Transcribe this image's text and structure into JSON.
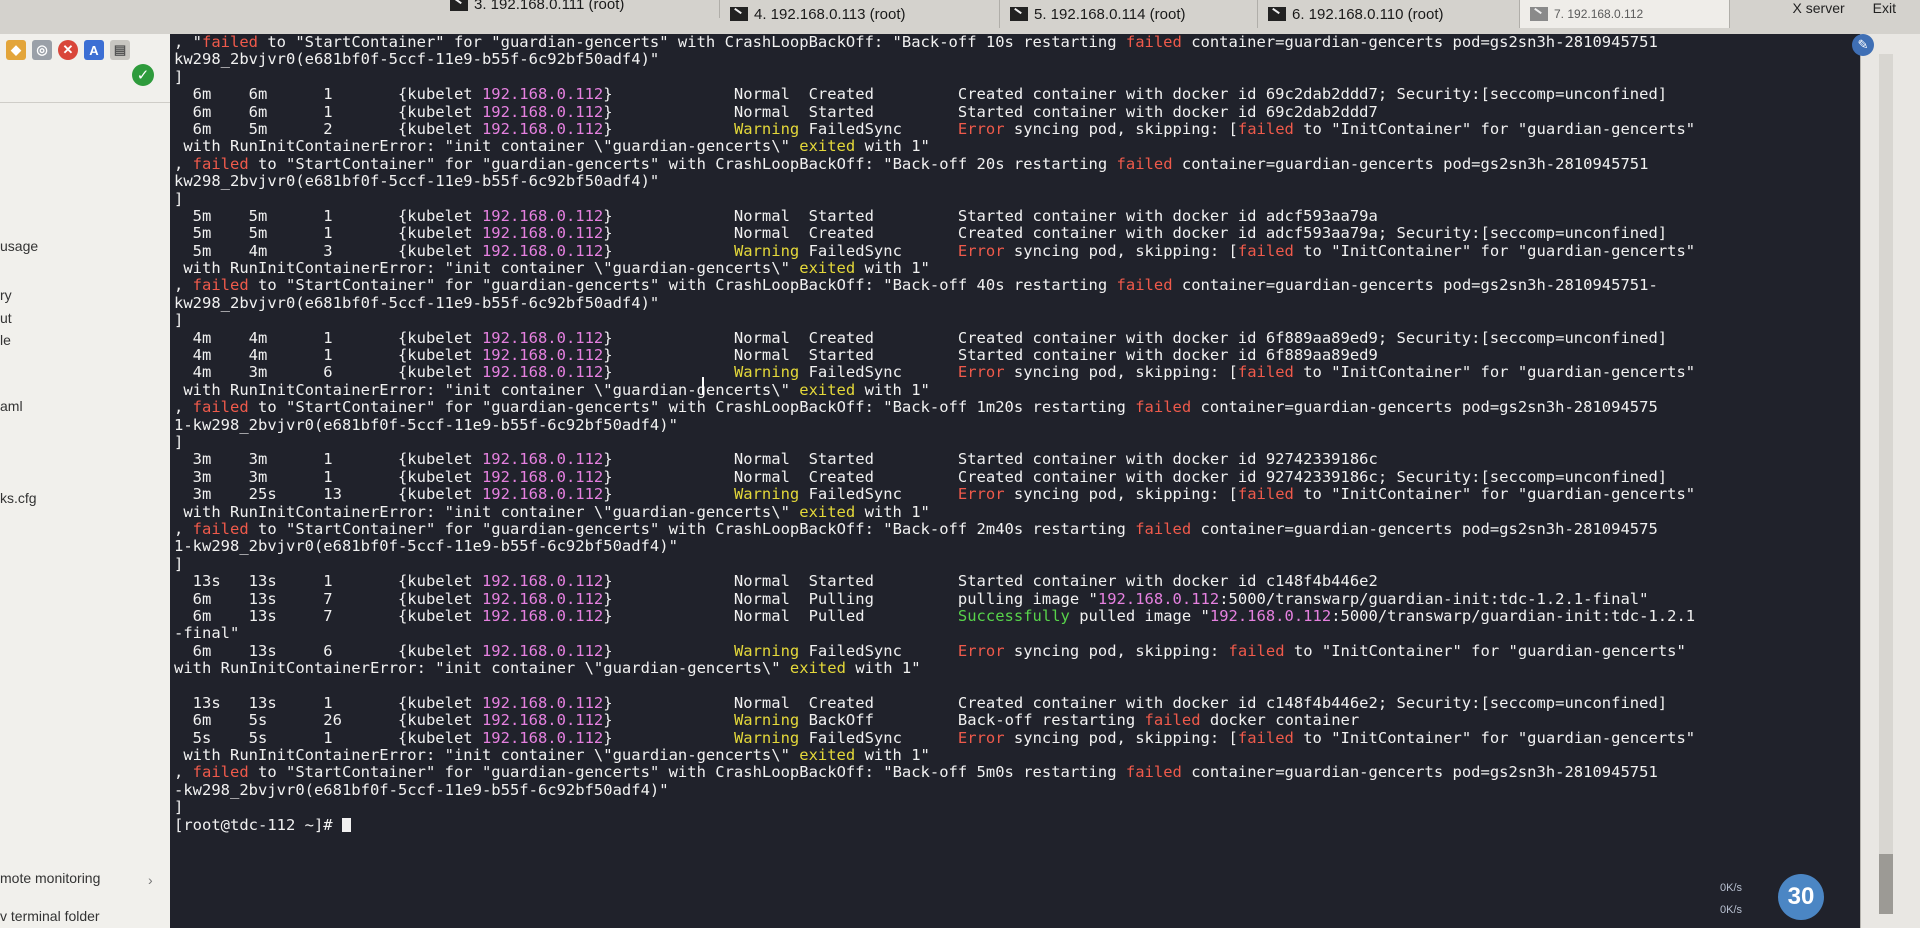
{
  "tabs": [
    {
      "label": "3. 192.168.0.111 (root)"
    },
    {
      "label": "4. 192.168.0.113 (root)"
    },
    {
      "label": "5. 192.168.0.114 (root)"
    },
    {
      "label": "6. 192.168.0.110 (root)"
    },
    {
      "label": "7. 192.168.0.112"
    }
  ],
  "window_controls": {
    "xserver": "X server",
    "exit": "Exit"
  },
  "sidebar": {
    "items": [
      "usage",
      "ry",
      "ut",
      "le",
      "aml",
      "ks.cfg",
      "mote monitoring",
      "v terminal folder"
    ],
    "expander": "›"
  },
  "terminal": {
    "lines": [
      [
        {
          "c": "w",
          "t": ", \""
        },
        {
          "c": "r",
          "t": "failed"
        },
        {
          "c": "w",
          "t": " to \"StartContainer\" for \"guardian-gencerts\" with CrashLoopBackOff: \"Back-off 10s restarting "
        },
        {
          "c": "r",
          "t": "failed"
        },
        {
          "c": "w",
          "t": " container=guardian-gencerts pod=gs2sn3h-2810945751"
        }
      ],
      [
        {
          "c": "w",
          "t": "kw298_2bvjvr0(e681bf0f-5ccf-11e9-b55f-6c92bf50adf4)\""
        }
      ],
      [
        {
          "c": "w",
          "t": "]"
        }
      ],
      [
        {
          "c": "w",
          "t": "  6m    6m      1       {kubelet "
        },
        {
          "c": "m",
          "t": "192.168.0.112"
        },
        {
          "c": "w",
          "t": "}             Normal  Created         Created container with docker id 69c2dab2ddd7; Security:[seccomp=unconfined]"
        }
      ],
      [
        {
          "c": "w",
          "t": "  6m    6m      1       {kubelet "
        },
        {
          "c": "m",
          "t": "192.168.0.112"
        },
        {
          "c": "w",
          "t": "}             Normal  Started         Started container with docker id 69c2dab2ddd7"
        }
      ],
      [
        {
          "c": "w",
          "t": "  6m    5m      2       {kubelet "
        },
        {
          "c": "m",
          "t": "192.168.0.112"
        },
        {
          "c": "w",
          "t": "}             "
        },
        {
          "c": "y",
          "t": "Warning"
        },
        {
          "c": "w",
          "t": " FailedSync      "
        },
        {
          "c": "r",
          "t": "Error"
        },
        {
          "c": "w",
          "t": " syncing pod, skipping: ["
        },
        {
          "c": "r",
          "t": "failed"
        },
        {
          "c": "w",
          "t": " to \"InitContainer\" for \"guardian-gencerts\""
        }
      ],
      [
        {
          "c": "w",
          "t": " with RunInitContainerError: \"init container \\\"guardian-gencerts\\\" "
        },
        {
          "c": "y",
          "t": "exited"
        },
        {
          "c": "w",
          "t": " with 1\""
        }
      ],
      [
        {
          "c": "w",
          "t": ", "
        },
        {
          "c": "r",
          "t": "failed"
        },
        {
          "c": "w",
          "t": " to \"StartContainer\" for \"guardian-gencerts\" with CrashLoopBackOff: \"Back-off 20s restarting "
        },
        {
          "c": "r",
          "t": "failed"
        },
        {
          "c": "w",
          "t": " container=guardian-gencerts pod=gs2sn3h-2810945751"
        }
      ],
      [
        {
          "c": "w",
          "t": "kw298_2bvjvr0(e681bf0f-5ccf-11e9-b55f-6c92bf50adf4)\""
        }
      ],
      [
        {
          "c": "w",
          "t": "]"
        }
      ],
      [
        {
          "c": "w",
          "t": "  5m    5m      1       {kubelet "
        },
        {
          "c": "m",
          "t": "192.168.0.112"
        },
        {
          "c": "w",
          "t": "}             Normal  Started         Started container with docker id adcf593aa79a"
        }
      ],
      [
        {
          "c": "w",
          "t": "  5m    5m      1       {kubelet "
        },
        {
          "c": "m",
          "t": "192.168.0.112"
        },
        {
          "c": "w",
          "t": "}             Normal  Created         Created container with docker id adcf593aa79a; Security:[seccomp=unconfined]"
        }
      ],
      [
        {
          "c": "w",
          "t": "  5m    4m      3       {kubelet "
        },
        {
          "c": "m",
          "t": "192.168.0.112"
        },
        {
          "c": "w",
          "t": "}             "
        },
        {
          "c": "y",
          "t": "Warning"
        },
        {
          "c": "w",
          "t": " FailedSync      "
        },
        {
          "c": "r",
          "t": "Error"
        },
        {
          "c": "w",
          "t": " syncing pod, skipping: ["
        },
        {
          "c": "r",
          "t": "failed"
        },
        {
          "c": "w",
          "t": " to \"InitContainer\" for \"guardian-gencerts\""
        }
      ],
      [
        {
          "c": "w",
          "t": " with RunInitContainerError: \"init container \\\"guardian-gencerts\\\" "
        },
        {
          "c": "y",
          "t": "exited"
        },
        {
          "c": "w",
          "t": " with 1\""
        }
      ],
      [
        {
          "c": "w",
          "t": ", "
        },
        {
          "c": "r",
          "t": "failed"
        },
        {
          "c": "w",
          "t": " to \"StartContainer\" for \"guardian-gencerts\" with CrashLoopBackOff: \"Back-off 40s restarting "
        },
        {
          "c": "r",
          "t": "failed"
        },
        {
          "c": "w",
          "t": " container=guardian-gencerts pod=gs2sn3h-2810945751-"
        }
      ],
      [
        {
          "c": "w",
          "t": "kw298_2bvjvr0(e681bf0f-5ccf-11e9-b55f-6c92bf50adf4)\""
        }
      ],
      [
        {
          "c": "w",
          "t": "]"
        }
      ],
      [
        {
          "c": "w",
          "t": "  4m    4m      1       {kubelet "
        },
        {
          "c": "m",
          "t": "192.168.0.112"
        },
        {
          "c": "w",
          "t": "}             Normal  Created         Created container with docker id 6f889aa89ed9; Security:[seccomp=unconfined]"
        }
      ],
      [
        {
          "c": "w",
          "t": "  4m    4m      1       {kubelet "
        },
        {
          "c": "m",
          "t": "192.168.0.112"
        },
        {
          "c": "w",
          "t": "}             Normal  Started         Started container with docker id 6f889aa89ed9"
        }
      ],
      [
        {
          "c": "w",
          "t": "  4m    3m      6       {kubelet "
        },
        {
          "c": "m",
          "t": "192.168.0.112"
        },
        {
          "c": "w",
          "t": "}             "
        },
        {
          "c": "y",
          "t": "Warning"
        },
        {
          "c": "w",
          "t": " FailedSync      "
        },
        {
          "c": "r",
          "t": "Error"
        },
        {
          "c": "w",
          "t": " syncing pod, skipping: ["
        },
        {
          "c": "r",
          "t": "failed"
        },
        {
          "c": "w",
          "t": " to \"InitContainer\" for \"guardian-gencerts\""
        }
      ],
      [
        {
          "c": "w",
          "t": " with RunInitContainerError: \"init container \\\"guardian-gencerts\\\" "
        },
        {
          "c": "y",
          "t": "exited"
        },
        {
          "c": "w",
          "t": " with 1\""
        }
      ],
      [
        {
          "c": "w",
          "t": ", "
        },
        {
          "c": "r",
          "t": "failed"
        },
        {
          "c": "w",
          "t": " to \"StartContainer\" for \"guardian-gencerts\" with CrashLoopBackOff: \"Back-off 1m20s restarting "
        },
        {
          "c": "r",
          "t": "failed"
        },
        {
          "c": "w",
          "t": " container=guardian-gencerts pod=gs2sn3h-281094575"
        }
      ],
      [
        {
          "c": "w",
          "t": "1-kw298_2bvjvr0(e681bf0f-5ccf-11e9-b55f-6c92bf50adf4)\""
        }
      ],
      [
        {
          "c": "w",
          "t": "]"
        }
      ],
      [
        {
          "c": "w",
          "t": "  3m    3m      1       {kubelet "
        },
        {
          "c": "m",
          "t": "192.168.0.112"
        },
        {
          "c": "w",
          "t": "}             Normal  Started         Started container with docker id 92742339186c"
        }
      ],
      [
        {
          "c": "w",
          "t": "  3m    3m      1       {kubelet "
        },
        {
          "c": "m",
          "t": "192.168.0.112"
        },
        {
          "c": "w",
          "t": "}             Normal  Created         Created container with docker id 92742339186c; Security:[seccomp=unconfined]"
        }
      ],
      [
        {
          "c": "w",
          "t": "  3m    25s     13      {kubelet "
        },
        {
          "c": "m",
          "t": "192.168.0.112"
        },
        {
          "c": "w",
          "t": "}             "
        },
        {
          "c": "y",
          "t": "Warning"
        },
        {
          "c": "w",
          "t": " FailedSync      "
        },
        {
          "c": "r",
          "t": "Error"
        },
        {
          "c": "w",
          "t": " syncing pod, skipping: ["
        },
        {
          "c": "r",
          "t": "failed"
        },
        {
          "c": "w",
          "t": " to \"InitContainer\" for \"guardian-gencerts\""
        }
      ],
      [
        {
          "c": "w",
          "t": " with RunInitContainerError: \"init container \\\"guardian-gencerts\\\" "
        },
        {
          "c": "y",
          "t": "exited"
        },
        {
          "c": "w",
          "t": " with 1\""
        }
      ],
      [
        {
          "c": "w",
          "t": ", "
        },
        {
          "c": "r",
          "t": "failed"
        },
        {
          "c": "w",
          "t": " to \"StartContainer\" for \"guardian-gencerts\" with CrashLoopBackOff: \"Back-off 2m40s restarting "
        },
        {
          "c": "r",
          "t": "failed"
        },
        {
          "c": "w",
          "t": " container=guardian-gencerts pod=gs2sn3h-281094575"
        }
      ],
      [
        {
          "c": "w",
          "t": "1-kw298_2bvjvr0(e681bf0f-5ccf-11e9-b55f-6c92bf50adf4)\""
        }
      ],
      [
        {
          "c": "w",
          "t": "]"
        }
      ],
      [
        {
          "c": "w",
          "t": "  13s   13s     1       {kubelet "
        },
        {
          "c": "m",
          "t": "192.168.0.112"
        },
        {
          "c": "w",
          "t": "}             Normal  Started         Started container with docker id c148f4b446e2"
        }
      ],
      [
        {
          "c": "w",
          "t": "  6m    13s     7       {kubelet "
        },
        {
          "c": "m",
          "t": "192.168.0.112"
        },
        {
          "c": "w",
          "t": "}             Normal  Pulling         pulling image \""
        },
        {
          "c": "m",
          "t": "192.168.0.112"
        },
        {
          "c": "w",
          "t": ":5000/transwarp/guardian-init:tdc-1.2.1-final\""
        }
      ],
      [
        {
          "c": "w",
          "t": "  6m    13s     7       {kubelet "
        },
        {
          "c": "m",
          "t": "192.168.0.112"
        },
        {
          "c": "w",
          "t": "}             Normal  Pulled          "
        },
        {
          "c": "g",
          "t": "Successfully"
        },
        {
          "c": "w",
          "t": " pulled image \""
        },
        {
          "c": "m",
          "t": "192.168.0.112"
        },
        {
          "c": "w",
          "t": ":5000/transwarp/guardian-init:tdc-1.2.1"
        }
      ],
      [
        {
          "c": "w",
          "t": "-final\""
        }
      ],
      [
        {
          "c": "w",
          "t": "  6m    13s     6       {kubelet "
        },
        {
          "c": "m",
          "t": "192.168.0.112"
        },
        {
          "c": "w",
          "t": "}             "
        },
        {
          "c": "y",
          "t": "Warning"
        },
        {
          "c": "w",
          "t": " FailedSync      "
        },
        {
          "c": "r",
          "t": "Error"
        },
        {
          "c": "w",
          "t": " syncing pod, skipping: "
        },
        {
          "c": "r",
          "t": "failed"
        },
        {
          "c": "w",
          "t": " to \"InitContainer\" for \"guardian-gencerts\""
        }
      ],
      [
        {
          "c": "w",
          "t": "with RunInitContainerError: \"init container \\\"guardian-gencerts\\\" "
        },
        {
          "c": "y",
          "t": "exited"
        },
        {
          "c": "w",
          "t": " with 1\""
        }
      ],
      [
        {
          "c": "w",
          "t": ""
        }
      ],
      [
        {
          "c": "w",
          "t": "  13s   13s     1       {kubelet "
        },
        {
          "c": "m",
          "t": "192.168.0.112"
        },
        {
          "c": "w",
          "t": "}             Normal  Created         Created container with docker id c148f4b446e2; Security:[seccomp=unconfined]"
        }
      ],
      [
        {
          "c": "w",
          "t": "  6m    5s      26      {kubelet "
        },
        {
          "c": "m",
          "t": "192.168.0.112"
        },
        {
          "c": "w",
          "t": "}             "
        },
        {
          "c": "y",
          "t": "Warning"
        },
        {
          "c": "w",
          "t": " BackOff         Back-off restarting "
        },
        {
          "c": "r",
          "t": "failed"
        },
        {
          "c": "w",
          "t": " docker container"
        }
      ],
      [
        {
          "c": "w",
          "t": "  5s    5s      1       {kubelet "
        },
        {
          "c": "m",
          "t": "192.168.0.112"
        },
        {
          "c": "w",
          "t": "}             "
        },
        {
          "c": "y",
          "t": "Warning"
        },
        {
          "c": "w",
          "t": " FailedSync      "
        },
        {
          "c": "r",
          "t": "Error"
        },
        {
          "c": "w",
          "t": " syncing pod, skipping: ["
        },
        {
          "c": "r",
          "t": "failed"
        },
        {
          "c": "w",
          "t": " to \"InitContainer\" for \"guardian-gencerts\""
        }
      ],
      [
        {
          "c": "w",
          "t": " with RunInitContainerError: \"init container \\\"guardian-gencerts\\\" "
        },
        {
          "c": "y",
          "t": "exited"
        },
        {
          "c": "w",
          "t": " with 1\""
        }
      ],
      [
        {
          "c": "w",
          "t": ", "
        },
        {
          "c": "r",
          "t": "failed"
        },
        {
          "c": "w",
          "t": " to \"StartContainer\" for \"guardian-gencerts\" with CrashLoopBackOff: \"Back-off 5m0s restarting "
        },
        {
          "c": "r",
          "t": "failed"
        },
        {
          "c": "w",
          "t": " container=guardian-gencerts pod=gs2sn3h-2810945751"
        }
      ],
      [
        {
          "c": "w",
          "t": "-kw298_2bvjvr0(e681bf0f-5ccf-11e9-b55f-6c92bf50adf4)\""
        }
      ],
      [
        {
          "c": "w",
          "t": "]"
        }
      ]
    ],
    "prompt": "[root@tdc-112 ~]# "
  },
  "network": {
    "up": "0K/s",
    "down": "0K/s",
    "badge": "30"
  },
  "colors": {
    "terminal_bg": "#20222b",
    "text": "#f1f1f1",
    "ip": "#e681e0",
    "failed": "#ef5a4b",
    "warning": "#e4d83a",
    "success": "#57d34a"
  }
}
